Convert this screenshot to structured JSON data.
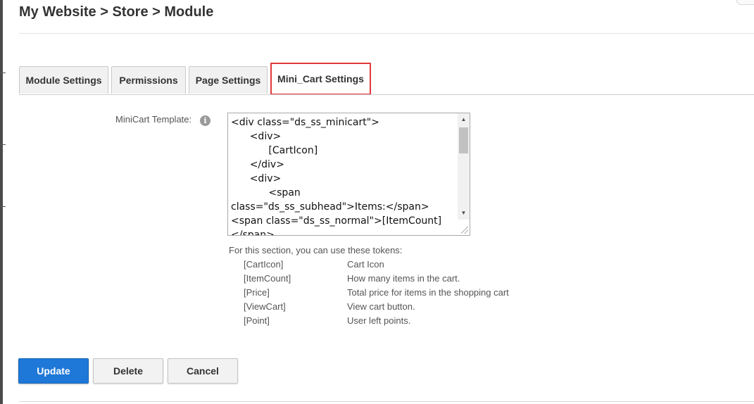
{
  "breadcrumb": "My Website > Store > Module",
  "tabs": [
    {
      "label": "Module Settings"
    },
    {
      "label": "Permissions"
    },
    {
      "label": "Page Settings"
    },
    {
      "label": "Mini_Cart Settings"
    }
  ],
  "active_tab": "Mini_Cart Settings",
  "form": {
    "minicart_label": "MiniCart Template:",
    "template_value": "<div class=\"ds_ss_minicart\">\n      <div>\n            [CartIcon]\n      </div>\n      <div>\n            <span class=\"ds_ss_subhead\">Items:</span>\n<span class=\"ds_ss_normal\">[ItemCount]\n</span>"
  },
  "tokens": {
    "intro": "For this section, you can use these tokens:",
    "items": [
      {
        "name": "[CartIcon]",
        "description": "Cart Icon"
      },
      {
        "name": "[ItemCount]",
        "description": "How many items in the cart."
      },
      {
        "name": "[Price]",
        "description": "Total price for items in the shopping cart"
      },
      {
        "name": "[ViewCart]",
        "description": "View cart button."
      },
      {
        "name": "[Point]",
        "description": "User left points."
      }
    ]
  },
  "actions": {
    "update": "Update",
    "delete": "Delete",
    "cancel": "Cancel"
  },
  "colors": {
    "primary_button": "#1e78d7",
    "active_tab_border": "#e0393a"
  },
  "icons": {
    "info": "info-icon",
    "scroll_up": "scroll-up-arrow-icon",
    "scroll_down": "scroll-down-arrow-icon",
    "resize": "resize-grip-icon"
  }
}
